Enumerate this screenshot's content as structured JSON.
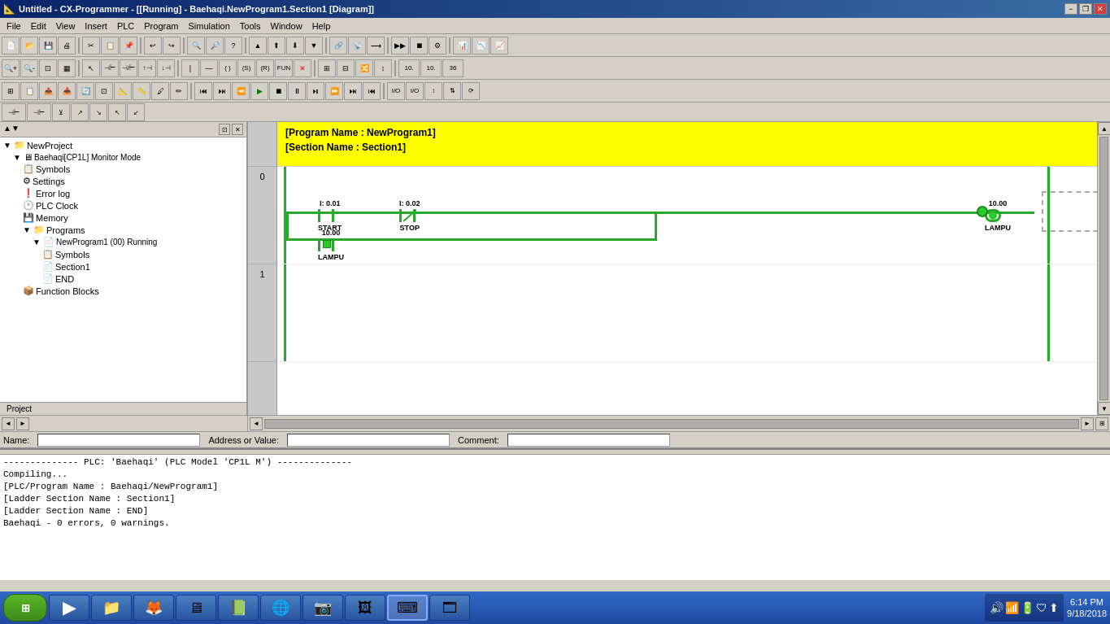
{
  "title": "Untitled - CX-Programmer - [[Running] - Baehaqi.NewProgram1.Section1 [Diagram]]",
  "menu": {
    "items": [
      "File",
      "Edit",
      "View",
      "Insert",
      "PLC",
      "Program",
      "Simulation",
      "Tools",
      "Window",
      "Help"
    ]
  },
  "sidebar": {
    "tab_label": "Project",
    "tree": [
      {
        "label": "NewProject",
        "indent": 0,
        "icon": "📁",
        "expand": true
      },
      {
        "label": "Baehaqi[CP1L] Monitor Mode",
        "indent": 1,
        "icon": "🖥",
        "expand": true
      },
      {
        "label": "Symbols",
        "indent": 2,
        "icon": "📋"
      },
      {
        "label": "Settings",
        "indent": 2,
        "icon": "⚙"
      },
      {
        "label": "Error log",
        "indent": 2,
        "icon": "❗"
      },
      {
        "label": "PLC Clock",
        "indent": 2,
        "icon": "🕐"
      },
      {
        "label": "Memory",
        "indent": 2,
        "icon": "💾"
      },
      {
        "label": "Programs",
        "indent": 2,
        "icon": "📁",
        "expand": true
      },
      {
        "label": "NewProgram1 (00) Running",
        "indent": 3,
        "icon": "📄",
        "expand": true
      },
      {
        "label": "Symbols",
        "indent": 4,
        "icon": "📋"
      },
      {
        "label": "Section1",
        "indent": 4,
        "icon": "📄"
      },
      {
        "label": "END",
        "indent": 4,
        "icon": "📄"
      },
      {
        "label": "Function Blocks",
        "indent": 2,
        "icon": "📦"
      }
    ]
  },
  "diagram": {
    "program_name": "[Program Name : NewProgram1]",
    "section_name": "[Section Name : Section1]",
    "rows": [
      "0",
      "1"
    ],
    "rung0": {
      "contact1_addr": "I: 0.01",
      "contact1_name": "START",
      "contact2_addr": "I: 0.02",
      "contact2_name": "STOP",
      "coil_addr": "10.00",
      "coil_name": "LAMPU",
      "branch_addr": "10.00",
      "branch_name": "LAMPU"
    }
  },
  "status_bar": {
    "name_label": "Name:",
    "address_label": "Address or Value:",
    "comment_label": "Comment:"
  },
  "output": {
    "lines": [
      "-------------- PLC: 'Baehaqi' (PLC Model 'CP1L M') --------------",
      "Compiling...",
      "[PLC/Program Name : Baehaqi/NewProgram1]",
      "[Ladder Section Name : Section1]",
      "[Ladder Section Name : END]",
      "",
      "Baehaqi - 0 errors, 0 warnings."
    ]
  },
  "taskbar": {
    "time": "6:14 PM",
    "date": "9/18/2018",
    "apps": [
      "🪟",
      "🎬",
      "📁",
      "🦊",
      "🖥",
      "📗",
      "🌐",
      "📷",
      "🖼",
      "⌨"
    ]
  },
  "title_controls": {
    "minimize": "−",
    "maximize": "□",
    "restore": "❐",
    "close": "✕"
  }
}
